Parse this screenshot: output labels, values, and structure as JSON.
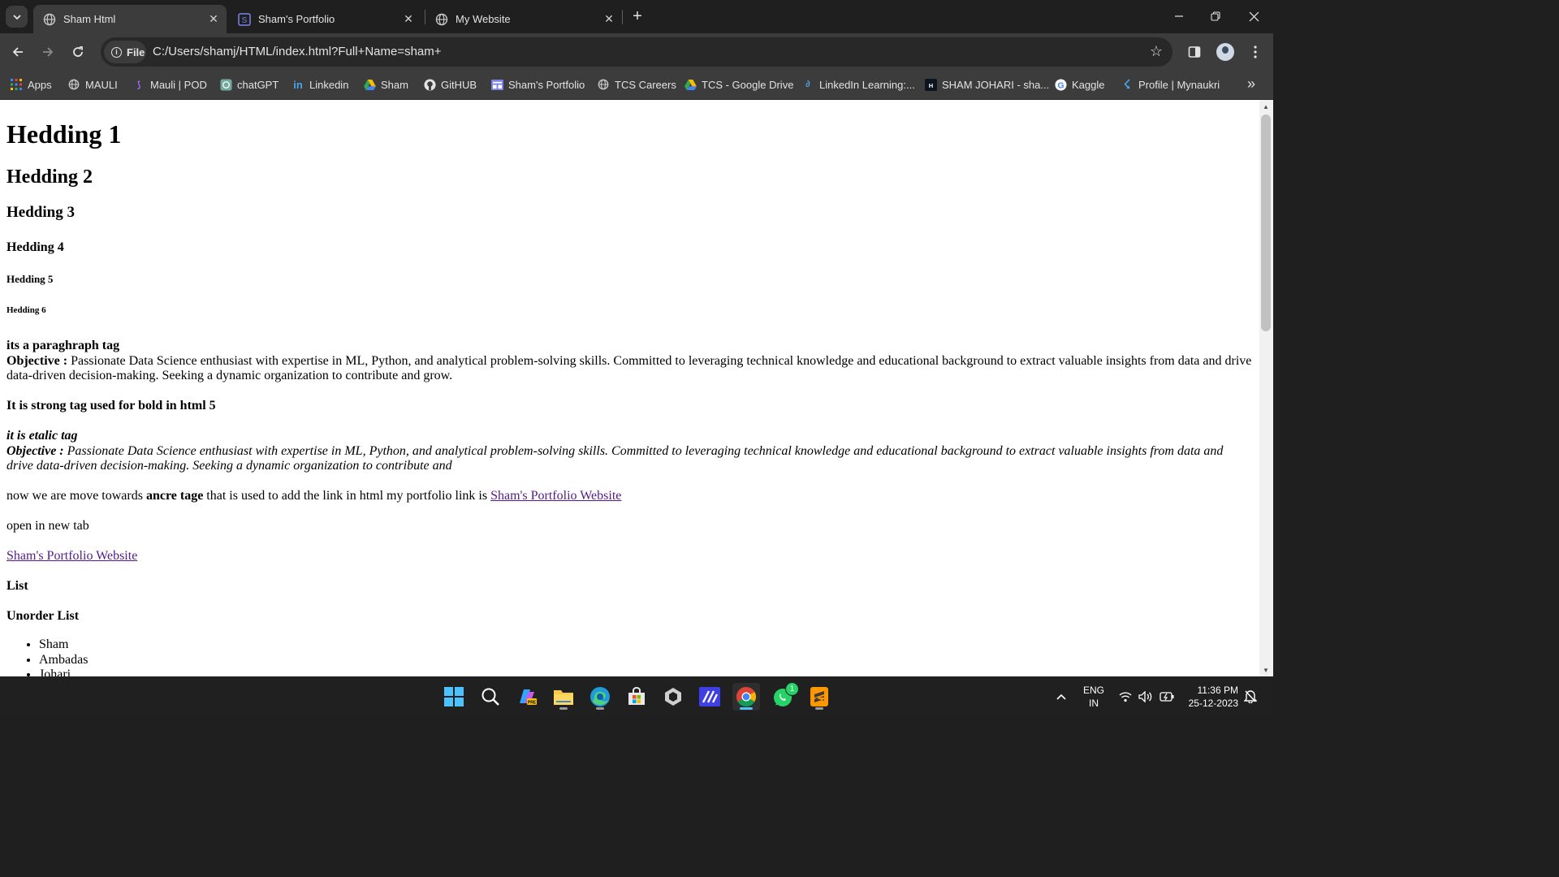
{
  "browser": {
    "tabs": [
      {
        "title": "Sham Html",
        "active": true,
        "icon": "globe-icon"
      },
      {
        "title": "Sham's Portfolio",
        "active": false,
        "icon": "portfolio-s-icon"
      },
      {
        "title": "My Website",
        "active": false,
        "icon": "globe-icon"
      }
    ],
    "address": {
      "scheme_chip": "File",
      "url": "C:/Users/shamj/HTML/index.html?Full+Name=sham+"
    },
    "bookmarks": [
      {
        "label": "Apps",
        "icon": "apps-grid-icon"
      },
      {
        "label": "MAULI",
        "icon": "globe-icon"
      },
      {
        "label": "Mauli | POD",
        "icon": "mauli-icon"
      },
      {
        "label": "chatGPT",
        "icon": "chatgpt-icon"
      },
      {
        "label": "Linkedin",
        "icon": "linkedin-icon"
      },
      {
        "label": "Sham",
        "icon": "google-drive-icon"
      },
      {
        "label": "GitHUB",
        "icon": "github-icon"
      },
      {
        "label": "Sham's Portfolio",
        "icon": "portfolio-icon"
      },
      {
        "label": "TCS Careers",
        "icon": "globe-icon"
      },
      {
        "label": "TCS - Google Drive",
        "icon": "google-drive-icon"
      },
      {
        "label": "LinkedIn Learning:...",
        "icon": "linkedin-learning-icon"
      },
      {
        "label": "SHAM JOHARI - sha...",
        "icon": "hackerrank-icon"
      },
      {
        "label": "Kaggle",
        "icon": "google-icon"
      },
      {
        "label": "Profile | Mynaukri",
        "icon": "naukri-icon"
      }
    ]
  },
  "page": {
    "h1": "Hedding 1",
    "h2": "Hedding 2",
    "h3": "Hedding 3",
    "h4": "Hedding 4",
    "h5": "Hedding 5",
    "h6": "Hedding 6",
    "para_tag_title": "its a paraghraph tag",
    "objective_label": "Objective :",
    "objective_text": " Passionate Data Science enthusiast with expertise in ML, Python, and analytical problem-solving skills. Committed to leveraging technical knowledge and educational background to extract valuable insights from data and drive data-driven decision-making. Seeking a dynamic organization to contribute and grow.",
    "strong_line": "It is strong tag used for bold in html 5",
    "italic_title": "it is etalic tag",
    "objective_label_2": "Objective :",
    "objective_text_italic": " Passionate Data Science enthusiast with expertise in ML, Python, and analytical problem-solving skills. Committed to leveraging technical knowledge and educational background to extract valuable insights from data and drive data-driven decision-making. Seeking a dynamic organization to contribute and",
    "anchor_intro_1": "now we are move towards ",
    "anchor_intro_bold": "ancre tage",
    "anchor_intro_2": " that is used to add the link in html my portfolio link is ",
    "portfolio_link": "Sham's Portfolio Website",
    "new_tab_text": "open in new tab",
    "portfolio_link_2": "Sham's Portfolio Website",
    "list_heading": "List",
    "unorder_heading": "Unorder List",
    "list_items": [
      "Sham",
      "Ambadas",
      "Johari"
    ]
  },
  "taskbar": {
    "apps": [
      "windows-start-icon",
      "search-icon",
      "copilot-icon",
      "file-explorer-icon",
      "edge-icon",
      "microsoft-store-icon",
      "unity-icon",
      "visual-studio-icon",
      "chrome-icon",
      "whatsapp-icon",
      "sublime-text-icon"
    ],
    "whatsapp_badge": "1",
    "language_line1": "ENG",
    "language_line2": "IN",
    "time": "11:36 PM",
    "date": "25-12-2023"
  },
  "colors": {
    "link_visited": "#551a8b",
    "chrome_dark": "#3c3c3c",
    "tab_strip": "#1f1f1f",
    "taskbar": "#202020"
  }
}
